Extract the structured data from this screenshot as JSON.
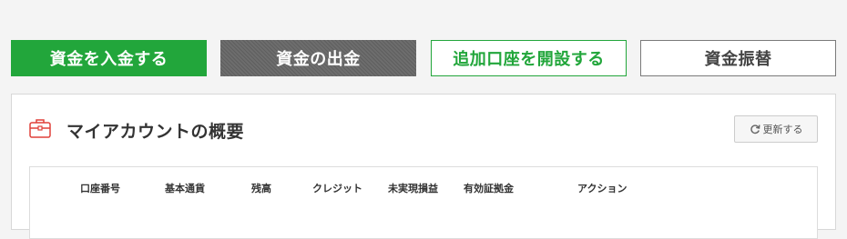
{
  "actions": {
    "deposit": "資金を入金する",
    "withdraw": "資金の出金",
    "open_account": "追加口座を開設する",
    "transfer": "資金振替"
  },
  "account_overview": {
    "title": "マイアカウントの概要",
    "refresh_label": "更新する",
    "columns": [
      "口座番号",
      "基本通貨",
      "残高",
      "クレジット",
      "未実現損益",
      "有効証拠金",
      "アクション"
    ]
  },
  "colors": {
    "primary_green": "#22a63b",
    "withdraw_gray": "#666666",
    "accent_red": "#e0413a"
  }
}
